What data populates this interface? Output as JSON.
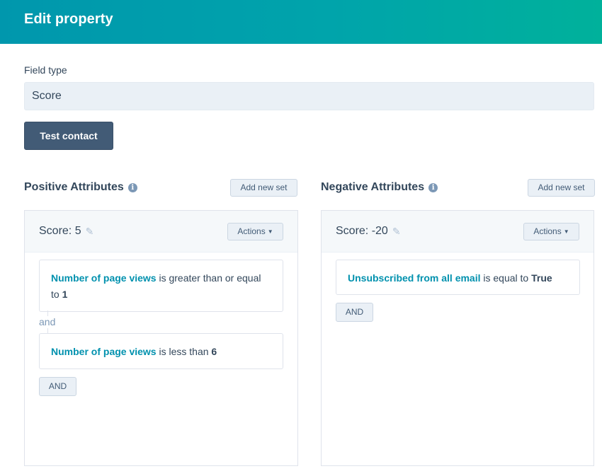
{
  "header": {
    "title": "Edit property"
  },
  "field": {
    "label": "Field type",
    "value": "Score"
  },
  "test_contact_label": "Test contact",
  "positive": {
    "title": "Positive Attributes",
    "info_icon": "info-icon",
    "add_set_label": "Add new set",
    "sets": [
      {
        "score_label": "Score: 5",
        "edit_icon": "pencil-icon",
        "actions_label": "Actions",
        "rules": [
          {
            "property": "Number of page views",
            "operator": " is greater than or equal to ",
            "value": "1"
          },
          {
            "property": "Number of page views",
            "operator": " is less than ",
            "value": "6"
          }
        ],
        "joiner": "and",
        "and_button": "AND"
      }
    ]
  },
  "negative": {
    "title": "Negative Attributes",
    "info_icon": "info-icon",
    "add_set_label": "Add new set",
    "sets": [
      {
        "score_label": "Score: -20",
        "edit_icon": "pencil-icon",
        "actions_label": "Actions",
        "rules": [
          {
            "property": "Unsubscribed from all email",
            "operator": " is equal to ",
            "value": "True"
          }
        ],
        "and_button": "AND"
      }
    ]
  },
  "colors": {
    "header_gradient_start": "#0097ad",
    "header_gradient_end": "#00b19b",
    "primary_button": "#425b76",
    "link": "#0091ae",
    "input_bg": "#eaf0f6"
  }
}
